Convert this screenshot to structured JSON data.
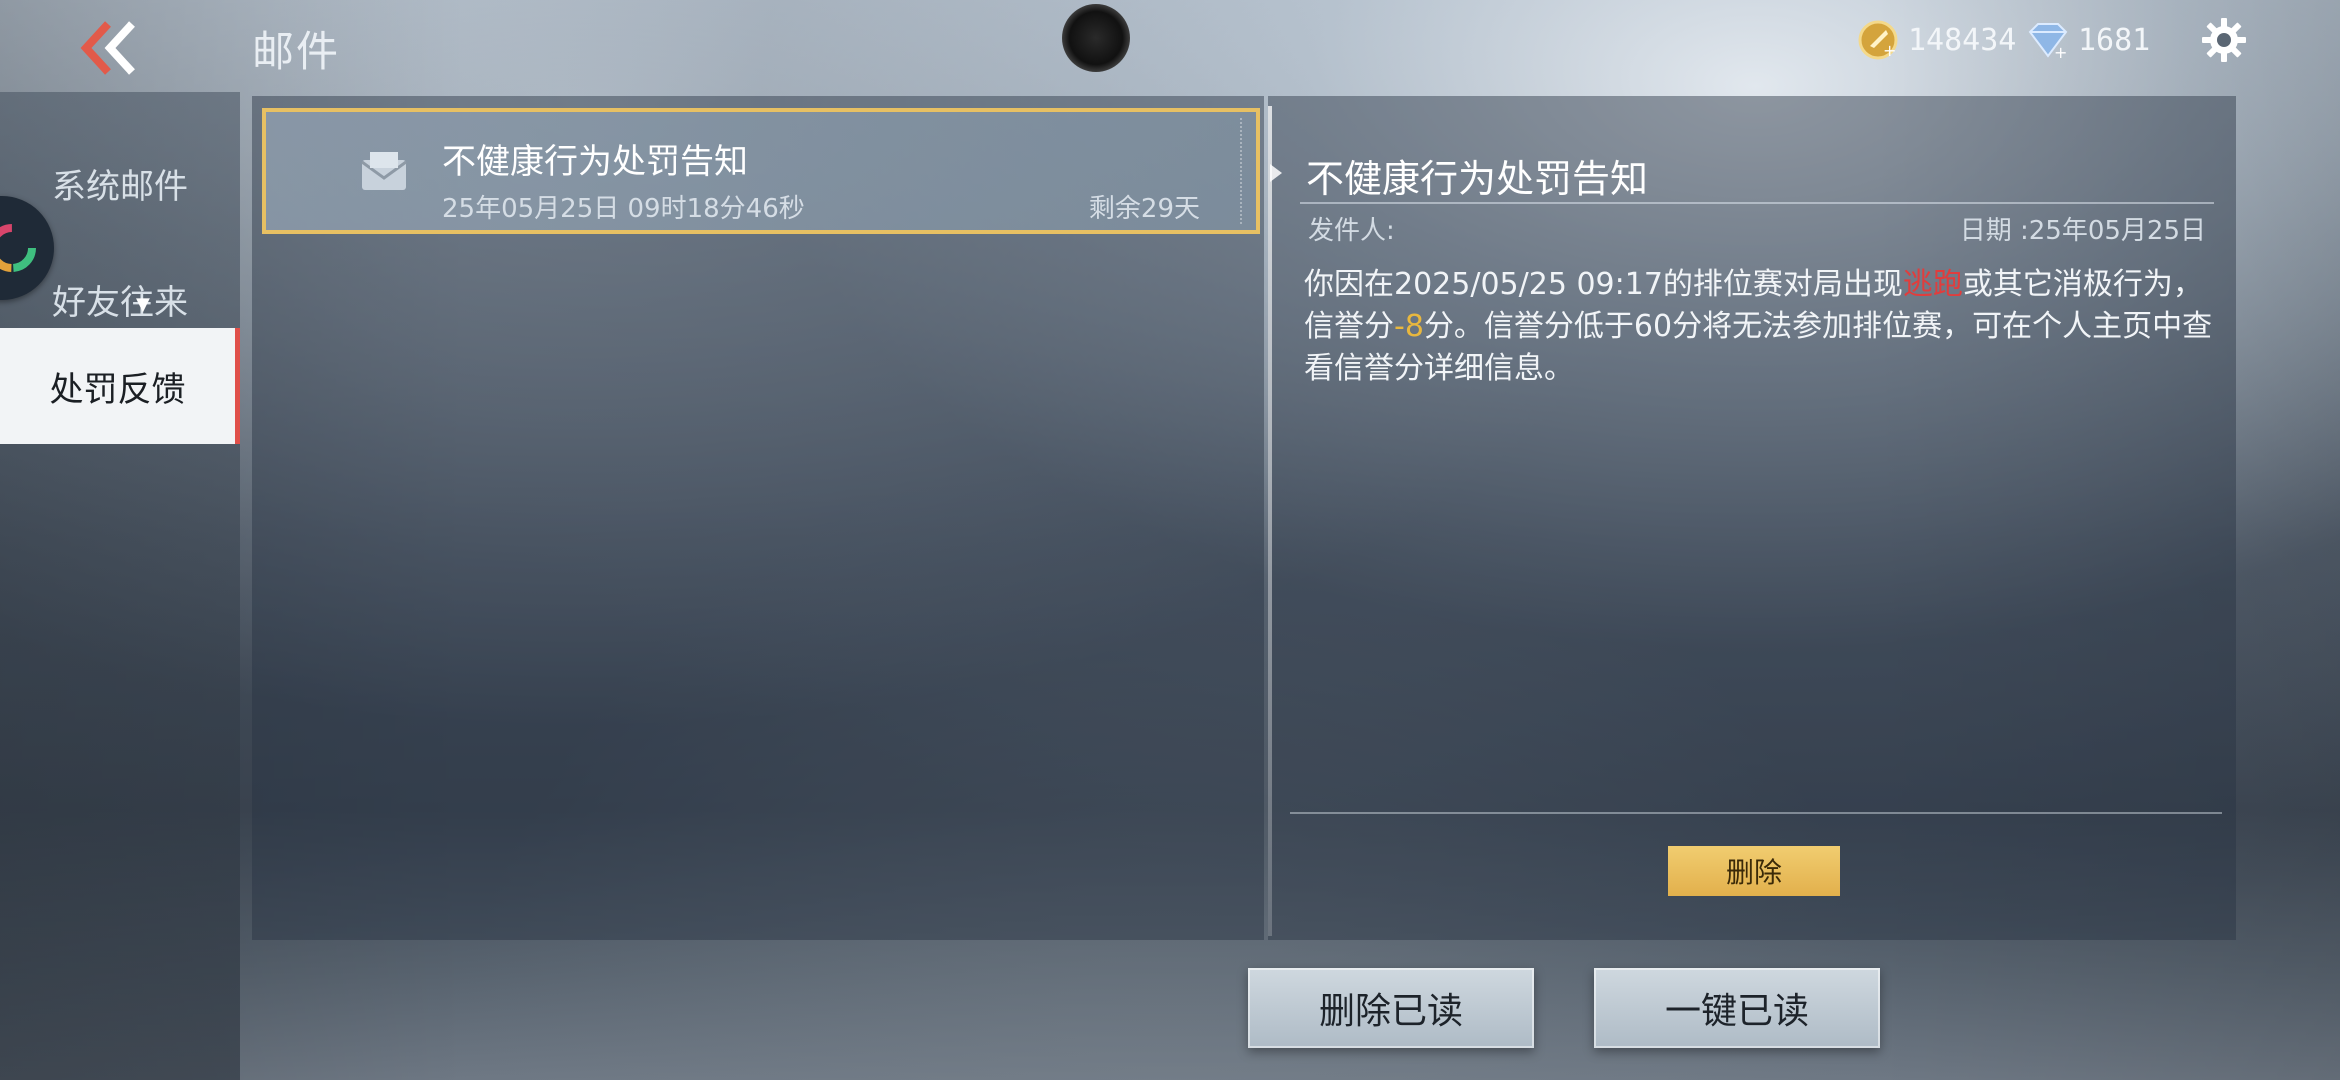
{
  "header": {
    "title": "邮件",
    "gold_amount": "148434",
    "diamond_amount": "1681"
  },
  "sidebar": {
    "items": [
      {
        "label": "系统邮件"
      },
      {
        "label": "好友往来"
      },
      {
        "label": "处罚反馈",
        "selected": true
      }
    ]
  },
  "mail_list": {
    "items": [
      {
        "subject": "不健康行为处罚告知",
        "time": "25年05月25日 09时18分46秒",
        "remaining": "剩余29天"
      }
    ]
  },
  "detail": {
    "title": "不健康行为处罚告知",
    "sender_label": "发件人:",
    "date_label": "日期 :25年05月25日",
    "body": {
      "part1": "你因在2025/05/25 09:17的排位赛对局出现",
      "highlight_red": "逃跑",
      "part2": "或其它消极行为，信誉分",
      "highlight_gold": "-8",
      "part3": "分。信誉分低于60分将无法参加排位赛，可在个人主页中查看信誉分详细信息。"
    },
    "delete_label": "删除"
  },
  "footer": {
    "delete_read_label": "删除已读",
    "mark_all_read_label": "一键已读"
  },
  "colors": {
    "accent_gold": "#e7c063",
    "alert_red": "#e03d3d",
    "selected_tab_border": "#e0504a"
  },
  "icons": {
    "back": "double-chevron-left-icon",
    "gold": "gold-coin-icon",
    "diamond": "diamond-icon",
    "settings": "gear-icon",
    "mail": "envelope-icon"
  }
}
